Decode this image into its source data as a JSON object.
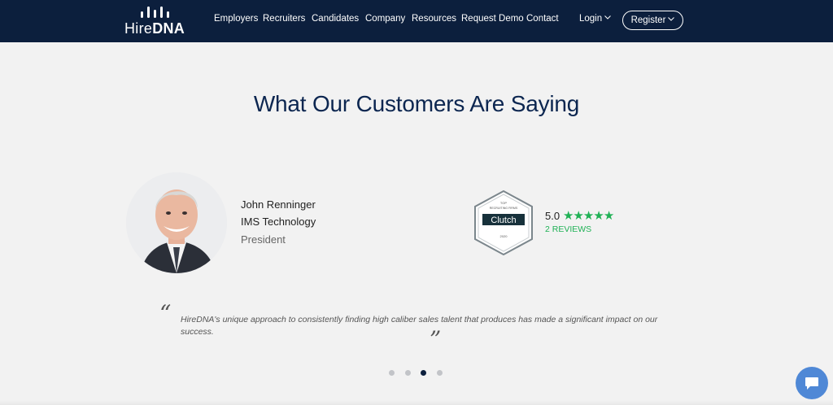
{
  "brand": {
    "logo_prefix": "Hire",
    "logo_suffix": "DNA"
  },
  "nav": {
    "items": [
      "Employers",
      "Recruiters",
      "Candidates",
      "Company",
      "Resources",
      "Request Demo",
      "Contact"
    ],
    "login": "Login",
    "register": "Register"
  },
  "section": {
    "title": "What Our Customers Are Saying"
  },
  "testimonial": {
    "name": "John Renninger",
    "company": "IMS Technology",
    "role": "President",
    "quote": "HireDNA's unique approach to consistently finding high caliber sales talent that produces has made a significant impact on our success."
  },
  "clutch": {
    "badge_top": "TOP",
    "badge_sub": "RECRUITING FIRMS",
    "badge_name": "Clutch",
    "badge_year": "2020",
    "score": "5.0",
    "stars": 5,
    "reviews": "2 REVIEWS"
  },
  "carousel": {
    "total": 4,
    "active": 3
  },
  "colors": {
    "nav_bg": "#0c1f3d",
    "title": "#0c2650",
    "star": "#1fb155",
    "chat": "#4f88d6"
  },
  "icons": {
    "chat": "chat-bubble-icon",
    "caret": "chevron-down-icon",
    "stars": "star-icon"
  }
}
